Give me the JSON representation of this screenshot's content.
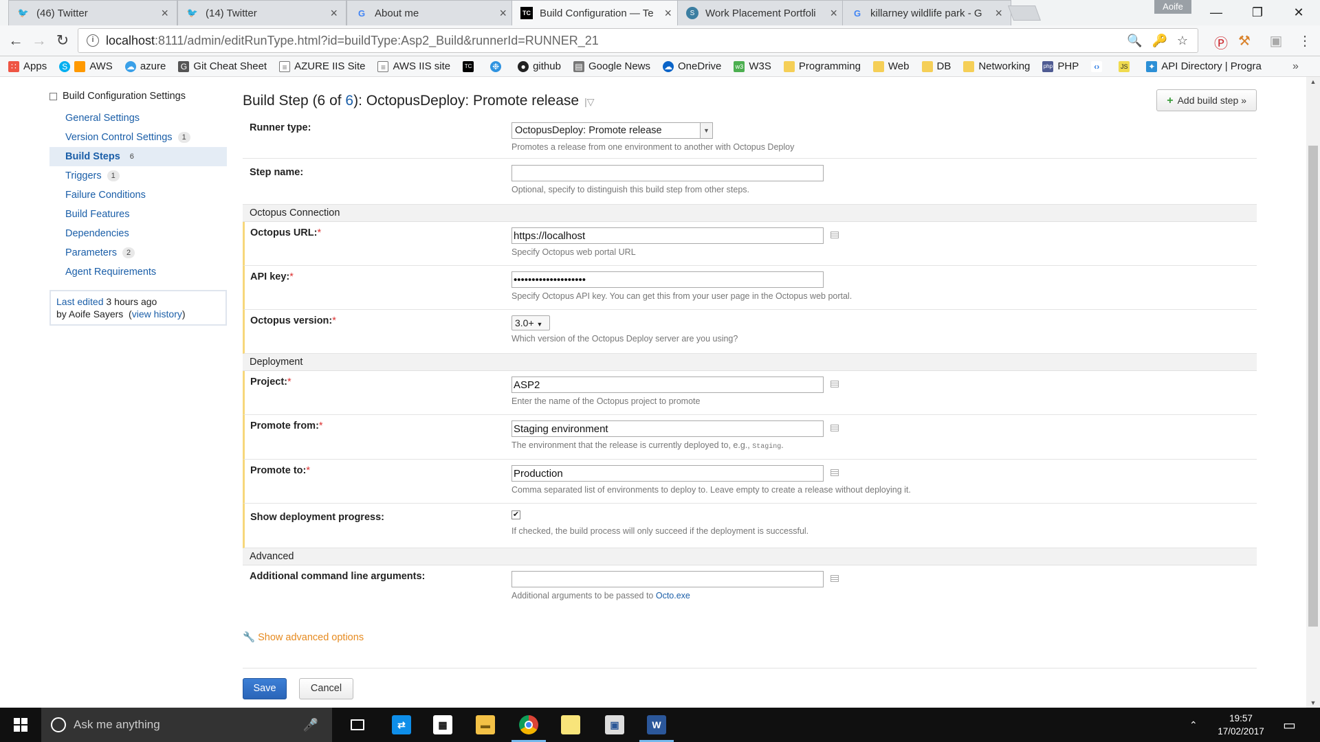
{
  "browser": {
    "tabs": [
      {
        "title": "(46) Twitter",
        "icon": "twitter-icon",
        "active": false
      },
      {
        "title": "(14) Twitter",
        "icon": "twitter-icon",
        "active": false
      },
      {
        "title": "About me",
        "icon": "google-icon",
        "active": false
      },
      {
        "title": "Build Configuration — Te",
        "icon": "teamcity-icon",
        "active": true
      },
      {
        "title": "Work Placement Portfoli",
        "icon": "portfolio-icon",
        "active": false
      },
      {
        "title": "killarney wildlife park - G",
        "icon": "google-icon",
        "active": false
      }
    ],
    "user": "Aoife",
    "url_host": "localhost",
    "url_rest": ":8111/admin/editRunType.html?id=buildType:Asp2_Build&runnerId=RUNNER_21",
    "bookmarks": [
      "Apps",
      "AWS",
      "azure",
      "Git Cheat Sheet",
      "AZURE IIS Site",
      "AWS IIS site",
      "github",
      "Google News",
      "OneDrive",
      "W3S",
      "Programming",
      "Web",
      "DB",
      "Networking",
      "PHP",
      "API Directory | Progra"
    ]
  },
  "sidebar": {
    "heading": "Build Configuration Settings",
    "items": [
      {
        "label": "General Settings",
        "count": ""
      },
      {
        "label": "Version Control Settings",
        "count": "1"
      },
      {
        "label": "Build Steps",
        "count": "6"
      },
      {
        "label": "Triggers",
        "count": "1"
      },
      {
        "label": "Failure Conditions",
        "count": ""
      },
      {
        "label": "Build Features",
        "count": ""
      },
      {
        "label": "Dependencies",
        "count": ""
      },
      {
        "label": "Parameters",
        "count": "2"
      },
      {
        "label": "Agent Requirements",
        "count": ""
      }
    ],
    "edited_link": "Last edited",
    "edited_time": " 3 hours ago",
    "edited_by": "by Aoife Sayers",
    "history_link": "view history"
  },
  "main": {
    "title_prefix": "Build Step (6 of ",
    "title_total": "6",
    "title_suffix": "): OctopusDeploy: Promote release",
    "add_step": "Add build step »",
    "runner_type_label": "Runner type:",
    "runner_type_value": "OctopusDeploy: Promote release",
    "runner_type_hint": "Promotes a release from one environment to another with Octopus Deploy",
    "step_name_label": "Step name:",
    "step_name_value": "",
    "step_name_hint": "Optional, specify to distinguish this build step from other steps.",
    "section_connection": "Octopus Connection",
    "octopus_url_label": "Octopus URL:",
    "octopus_url_value": "https://localhost",
    "octopus_url_hint": "Specify Octopus web portal URL",
    "api_key_label": "API key:",
    "api_key_value": "••••••••••••••••••••",
    "api_key_hint": "Specify Octopus API key. You can get this from your user page in the Octopus web portal.",
    "version_label": "Octopus version:",
    "version_value": "3.0+",
    "version_hint": "Which version of the Octopus Deploy server are you using?",
    "section_deployment": "Deployment",
    "project_label": "Project:",
    "project_value": "ASP2",
    "project_hint": "Enter the name of the Octopus project to promote",
    "promote_from_label": "Promote from:",
    "promote_from_value": "Staging environment",
    "promote_from_hint": "The environment that the release is currently deployed to, e.g., ",
    "promote_from_hint_code": "Staging",
    "promote_to_label": "Promote to:",
    "promote_to_value": "Production",
    "promote_to_hint": "Comma separated list of environments to deploy to. Leave empty to create a release without deploying it.",
    "progress_label": "Show deployment progress:",
    "progress_checked": true,
    "progress_hint": "If checked, the build process will only succeed if the deployment is successful.",
    "section_advanced": "Advanced",
    "args_label": "Additional command line arguments:",
    "args_value": "",
    "args_hint": "Additional arguments to be passed to ",
    "args_hint_link": "Octo.exe",
    "show_advanced": "Show advanced options",
    "save": "Save",
    "cancel": "Cancel"
  },
  "taskbar": {
    "search_placeholder": "Ask me anything",
    "time": "19:57",
    "date": "17/02/2017"
  },
  "colors": {
    "link": "#1a5ea8",
    "required_bar": "#f7d77b",
    "save_button": "#2a65b8",
    "advanced_link": "#e68a1f"
  }
}
